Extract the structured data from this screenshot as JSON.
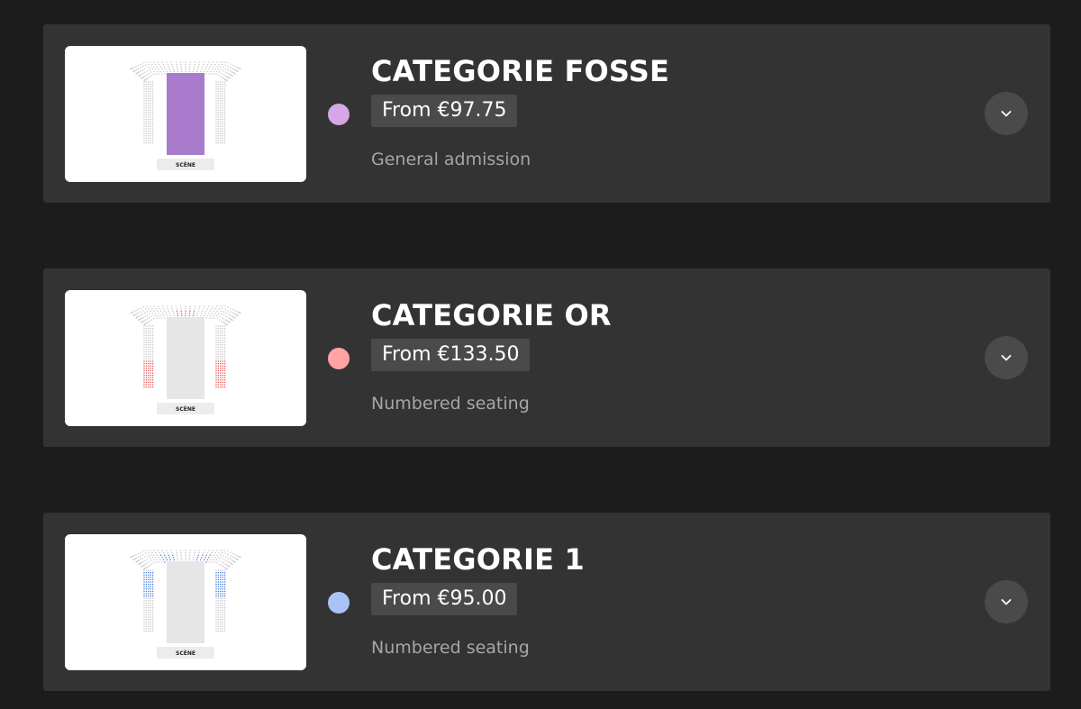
{
  "categories": [
    {
      "title": "CATEGORIE FOSSE",
      "price": "From €97.75",
      "seating": "General admission",
      "color": "#d6a6e6",
      "highlight": "floor",
      "highlight_color": "#a87bcc",
      "stage_label": "SCÈNE",
      "expand_icon": "chevron-down-icon"
    },
    {
      "title": "CATEGORIE OR",
      "price": "From €133.50",
      "seating": "Numbered seating",
      "color": "#ffa3a3",
      "highlight": "or",
      "highlight_color": "#e05a5a",
      "stage_label": "SCÈNE",
      "expand_icon": "chevron-down-icon"
    },
    {
      "title": "CATEGORIE 1",
      "price": "From €95.00",
      "seating": "Numbered seating",
      "color": "#a8c4f5",
      "highlight": "cat1",
      "highlight_color": "#4a7fd9",
      "stage_label": "SCÈNE",
      "expand_icon": "chevron-down-icon"
    }
  ],
  "colors": {
    "background": "#1c1c1c",
    "card": "#333333",
    "price_badge": "#4a4a4a",
    "seat_default": "#c8c8c8",
    "floor_default": "#e6e6e6"
  }
}
